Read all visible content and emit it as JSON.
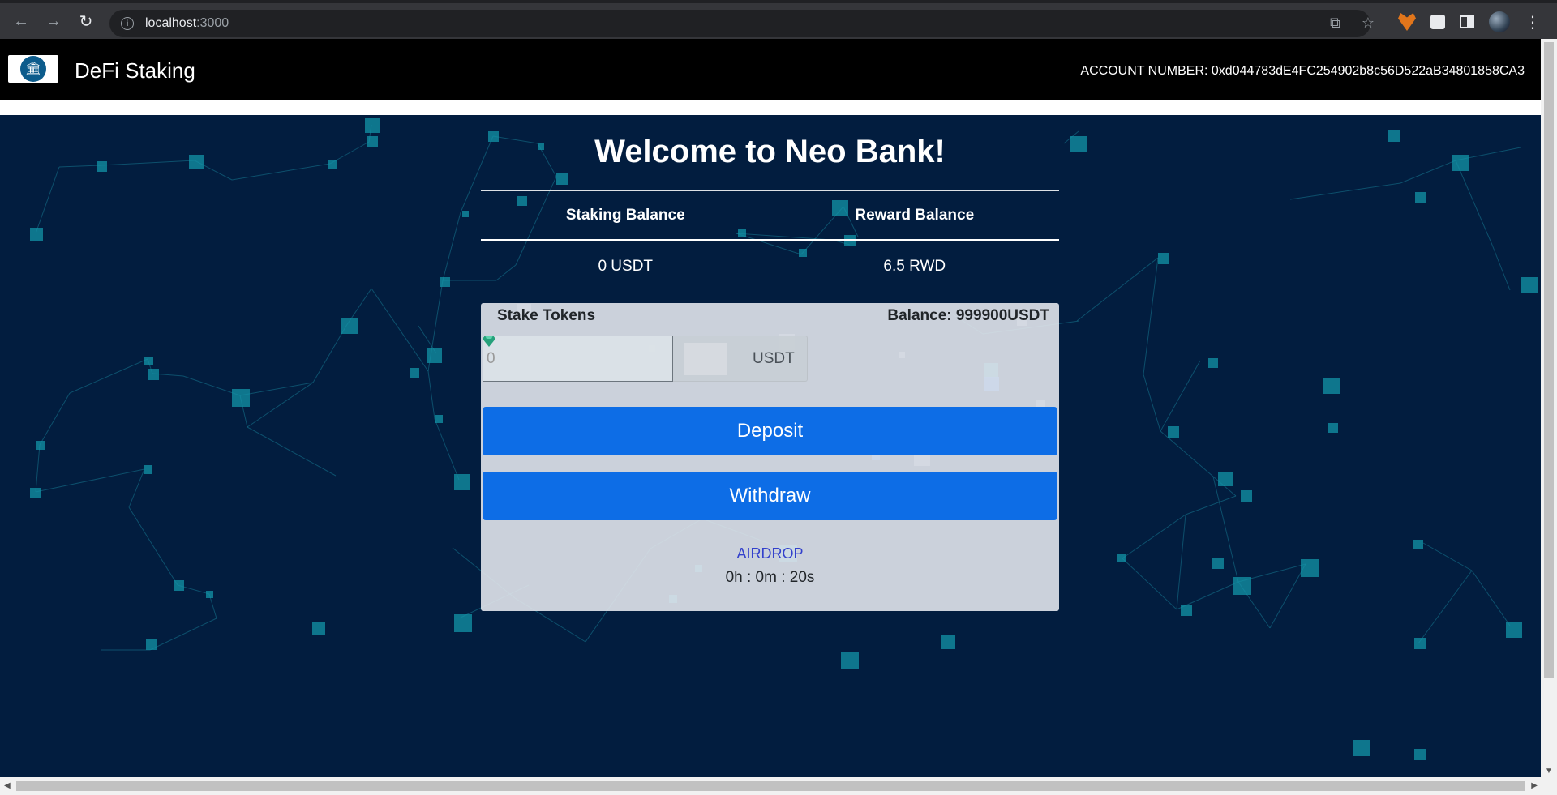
{
  "browser": {
    "url_host": "localhost",
    "url_port": ":3000"
  },
  "navbar": {
    "brand": "DeFi Staking",
    "account_label": "ACCOUNT NUMBER: 0xd044783dE4FC254902b8c56D522aB34801858CA3"
  },
  "main": {
    "welcome": "Welcome to Neo Bank!",
    "balances": {
      "staking_header": "Staking Balance",
      "reward_header": "Reward Balance",
      "staking_value": "0 USDT",
      "reward_value": "6.5 RWD"
    },
    "stake_card": {
      "title": "Stake Tokens",
      "balance": "Balance: 999900USDT",
      "amount_placeholder": "0",
      "token_label": "USDT",
      "deposit_label": "Deposit",
      "withdraw_label": "Withdraw",
      "airdrop_label": "AIRDROP",
      "timer": "0h : 0m : 20s"
    }
  },
  "colors": {
    "background": "#021d3f",
    "button": "#0d6de6",
    "navbar": "#000000",
    "airdrop_link": "#3341cc"
  }
}
